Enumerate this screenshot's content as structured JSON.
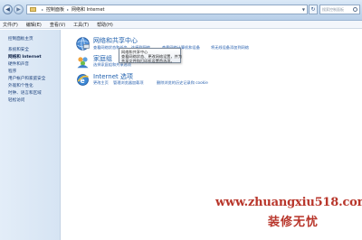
{
  "address_bar": {
    "segments": [
      "控制面板",
      "网络和 Internet"
    ],
    "search_placeholder": "搜索控制面板"
  },
  "menu": [
    "文件(F)",
    "编辑(E)",
    "查看(V)",
    "工具(T)",
    "帮助(H)"
  ],
  "left_pane": {
    "items": [
      {
        "label": "控制面板主页",
        "current": false
      },
      {
        "label": "系统和安全",
        "current": false
      },
      {
        "label": "网络和 Internet",
        "current": true
      },
      {
        "label": "硬件和声音",
        "current": false
      },
      {
        "label": "程序",
        "current": false
      },
      {
        "label": "用户帐户和家庭安全",
        "current": false
      },
      {
        "label": "外观和个性化",
        "current": false
      },
      {
        "label": "时钟、语言和区域",
        "current": false
      },
      {
        "label": "轻松访问",
        "current": false
      }
    ]
  },
  "categories": [
    {
      "title": "网络和共享中心",
      "links": [
        "查看网络状态和任务",
        "连接到网络",
        "查看网络计算机和设备",
        "将无线设备添加到网络"
      ]
    },
    {
      "title": "家庭组",
      "links": [
        "选择家庭组和共享选项"
      ]
    },
    {
      "title": "Internet 选项",
      "links": [
        "更改主页",
        "管理浏览器加载项",
        "删除浏览的历史记录和 cookie"
      ]
    }
  ],
  "tooltip": {
    "lines": [
      "网络和共享中心",
      "查看网络状态、更改网络设置，并为",
      "共享文件和打印机设置首选项。"
    ]
  },
  "watermark": {
    "url": "www.zhuangxiu518.com",
    "text": "装修无忧"
  },
  "colors": {
    "link": "#2b63b0",
    "title": "#1e5fad",
    "watermark": "#b8362b",
    "left_pane": "#dbe8f5"
  }
}
